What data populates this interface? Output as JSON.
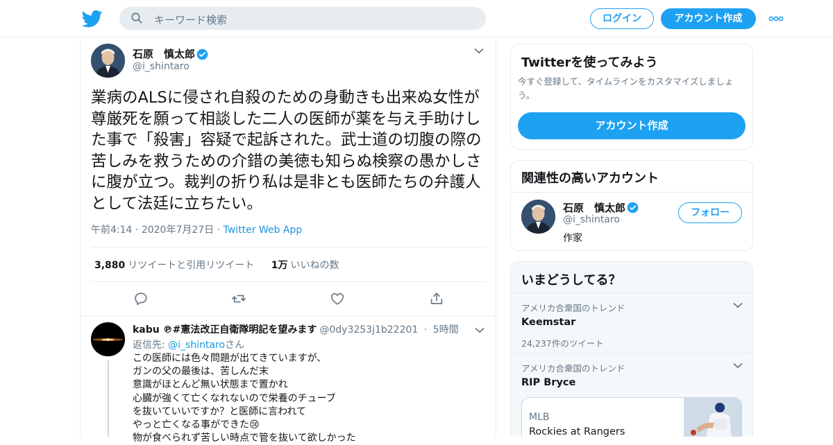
{
  "header": {
    "search_placeholder": "キーワード検索",
    "login_label": "ログイン",
    "signup_label": "アカウント作成"
  },
  "tweet": {
    "author_name": "石原　慎太郎",
    "author_handle": "@i_shintaro",
    "text": "業病のALSに侵され自殺のための身動きも出来ぬ女性が尊厳死を願って相談した二人の医師が薬を与え手助けした事で「殺害」容疑で起訴された。武士道の切腹の際の苦しみを救うための介錯の美徳も知らぬ検察の愚かしさに腹が立つ。裁判の折り私は是非とも医師たちの弁護人として法廷に立ちたい。",
    "time": "午前4:14",
    "date": "2020年7月27日",
    "source": "Twitter Web App",
    "retweet_count": "3,880",
    "retweet_label": "リツイートと引用リツイート",
    "like_count": "1万",
    "like_label": "いいねの数"
  },
  "reply": {
    "name": "kabu ℗#憲法改正自衛隊明記を望みます",
    "handle": "@0dy3253j1b22201",
    "time": "5時間",
    "reply_to_prefix": "返信先: ",
    "reply_to_handle": "@i_shintaro",
    "reply_to_suffix": "さん",
    "lines": [
      "この医師には色々問題が出てきていますが、",
      "ガンの父の最後は、苦しんだ末",
      "意識がほとんど無い状態まで置かれ",
      "心臓が強くて亡くなれないので栄養のチューブ",
      "を抜いていいですか？と医師に言われて",
      "やっと亡くなる事ができた😢",
      "物が食べられず苦しい時点で管を抜いて欲しかった"
    ]
  },
  "sidebar": {
    "signup_card": {
      "title": "Twitterを使ってみよう",
      "subtitle": "今すぐ登録して、タイムラインをカスタマイズしましょう。",
      "button": "アカウント作成"
    },
    "related": {
      "title": "関連性の高いアカウント",
      "name": "石原　慎太郎",
      "handle": "@i_shintaro",
      "bio": "作家",
      "follow_label": "フォロー"
    },
    "trends": {
      "title": "いまどうしてる？",
      "items": [
        {
          "context": "アメリカ合衆国のトレンド",
          "name": "Keemstar",
          "count": "24,237件のツイート"
        },
        {
          "context": "アメリカ合衆国のトレンド",
          "name": "RIP Bryce"
        }
      ],
      "news": {
        "category": "MLB",
        "headline": "Rockies at Rangers"
      }
    }
  },
  "colors": {
    "accent": "#1da1f2",
    "link": "#1b95e0",
    "muted": "#657786",
    "border": "#e6ecf0"
  }
}
